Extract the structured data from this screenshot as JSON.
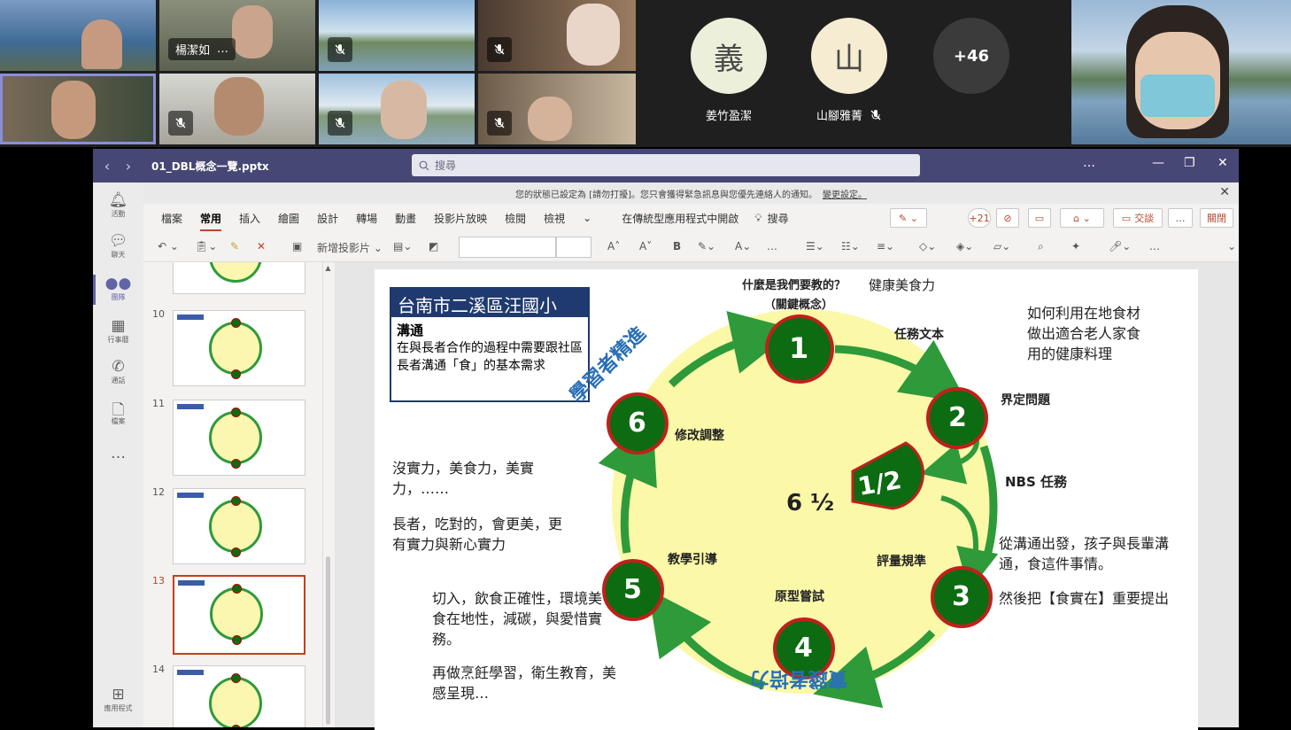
{
  "meeting": {
    "tiles": [
      {
        "name": "楊潔如",
        "more": "…",
        "mic_muted": false
      },
      {
        "mic_muted": true
      },
      {
        "mic_muted": true
      },
      {
        "mic_muted": true
      },
      {
        "mic_muted": true
      }
    ],
    "avatars": [
      {
        "initial": "義",
        "name": "姜竹盈潔",
        "color": "#ecefd9",
        "mic_muted": false
      },
      {
        "initial": "山",
        "name": "山腳雅菁",
        "color": "#f6ecd2",
        "mic_muted": true
      },
      {
        "initial": "+46",
        "name": "",
        "color": "#3b3b3b"
      }
    ]
  },
  "app": {
    "file_name": "01_DBL概念一覽.pptx",
    "search_placeholder": "搜尋",
    "more": "…",
    "rail": [
      {
        "label": "活動",
        "icon": "bell-icon"
      },
      {
        "label": "聊天",
        "icon": "chat-icon"
      },
      {
        "label": "團隊",
        "icon": "teams-icon"
      },
      {
        "label": "行事曆",
        "icon": "calendar-icon"
      },
      {
        "label": "通話",
        "icon": "phone-icon"
      },
      {
        "label": "檔案",
        "icon": "file-icon"
      },
      {
        "label": "…",
        "icon": "more-icon"
      },
      {
        "label": "應用程式",
        "icon": "apps-icon"
      }
    ],
    "info_bar": {
      "text": "您的狀態已設定為 [請勿打擾]。您只會獲得緊急訊息與您優先連絡人的通知。",
      "link": "變更設定。"
    }
  },
  "ribbon": {
    "tabs": [
      "檔案",
      "常用",
      "插入",
      "繪圖",
      "設計",
      "轉場",
      "動畫",
      "投影片放映",
      "檢閱",
      "檢視"
    ],
    "active_tab": "常用",
    "open_desktop": "在傳統型應用程式中開啟",
    "search_label": "搜尋",
    "coauthors": "+21",
    "comment_label": "交談",
    "close_label": "關閉",
    "new_slide": "新增投影片"
  },
  "thumbnails": [
    {
      "num": "10",
      "badge": "#a4262c"
    },
    {
      "num": "11",
      "badge": "#8764b8"
    },
    {
      "num": "12",
      "badge": "#444444"
    },
    {
      "num": "13",
      "badge": "#0f6e8c",
      "active": true
    },
    {
      "num": "14",
      "badge": "#8a6a5a"
    }
  ],
  "slide": {
    "school": "台南市二溪區汪國小",
    "focus_title": "溝通",
    "focus_desc": "在與長者合作的過程中需要跟社區長者溝通「食」的基本需求",
    "question": "什麼是我們要教的？",
    "question_answer": "健康美食力",
    "key_concept": "（關鍵概念）",
    "steps": [
      {
        "num": "1",
        "label": "任務文本"
      },
      {
        "num": "2",
        "label": "界定問題"
      },
      {
        "num": "3",
        "label": "評量規準"
      },
      {
        "num": "4",
        "label": "原型嘗試"
      },
      {
        "num": "5",
        "label": "教學引導"
      },
      {
        "num": "6",
        "label": "修改調整"
      }
    ],
    "half_label": "1/2",
    "center": "6 ½",
    "nbs": "NBS 任務",
    "arc_top_left": "學習者精進",
    "arc_bottom": "實踐者培力",
    "note_top_right": "如何利用在地食材做出適合老人家食用的健康料理",
    "note_mid_right_1": "從溝通出發，孩子與長輩溝通，食這件事情。",
    "note_mid_right_2": "然後把【食實在】重要提出",
    "note_left_1": "沒實力，美食力，美實力，……",
    "note_left_2": "長者，吃對的，會更美，更有實力與新心實力",
    "note_bottom_1": "切入，飲食正確性，環境美食在地性，減碳，與愛惜實務。",
    "note_bottom_2": "再做烹飪學習，衛生教育，美感呈現…"
  },
  "colors": {
    "teams_purple": "#464775",
    "ppt_red": "#b7472a",
    "cycle_green": "#2e9a3a",
    "step_green": "#0d6b12",
    "step_red": "#c0201c",
    "cycle_fill": "#fbf8a8",
    "school_blue": "#1f3a6e"
  }
}
